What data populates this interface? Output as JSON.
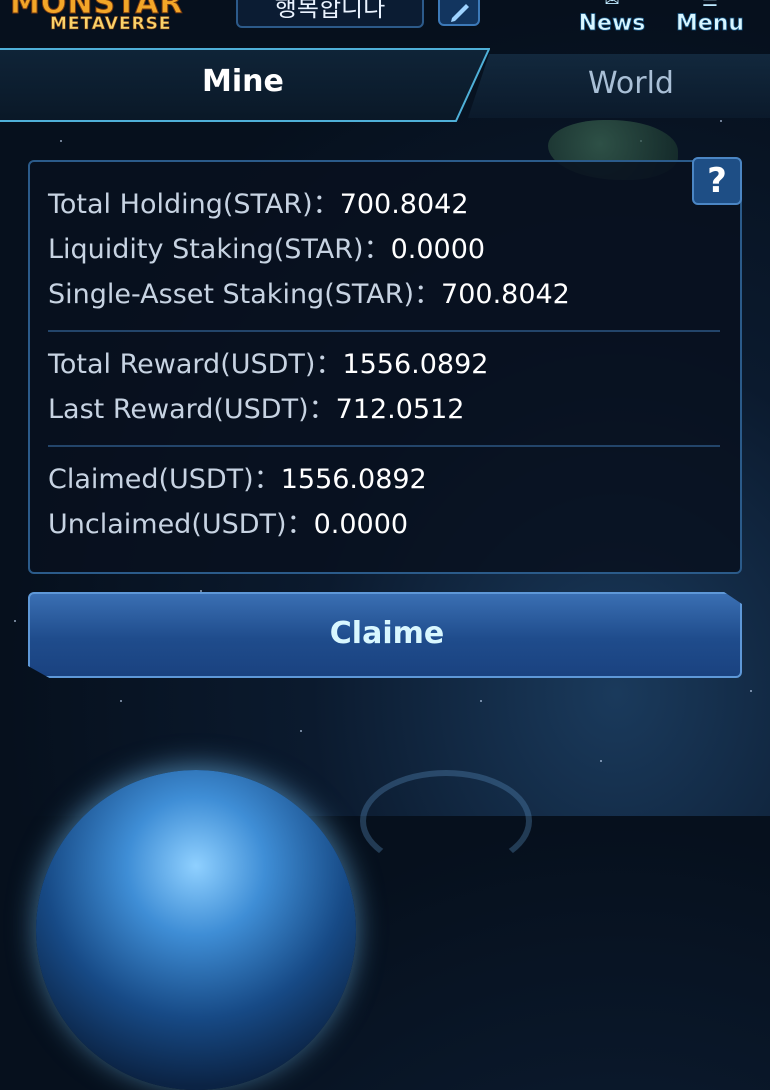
{
  "header": {
    "logo_title": "MONSTAR",
    "logo_subtitle": "METAVERSE",
    "username": "행복합니다",
    "news_label": "News",
    "menu_label": "Menu"
  },
  "tabs": [
    {
      "label": "Mine",
      "active": true
    },
    {
      "label": "World",
      "active": false
    }
  ],
  "stats": {
    "total_holding": {
      "label": "Total Holding(STAR)：",
      "value": "700.8042"
    },
    "liquidity_staking": {
      "label": "Liquidity Staking(STAR)：",
      "value": "0.0000"
    },
    "single_asset_staking": {
      "label": "Single-Asset Staking(STAR)：",
      "value": "700.8042"
    },
    "total_reward": {
      "label": "Total Reward(USDT)：",
      "value": "1556.0892"
    },
    "last_reward": {
      "label": "Last Reward(USDT)：",
      "value": "712.0512"
    },
    "claimed": {
      "label": "Claimed(USDT)：",
      "value": "1556.0892"
    },
    "unclaimed": {
      "label": "Unclaimed(USDT)：",
      "value": "0.0000"
    }
  },
  "help_label": "?",
  "claim_button_label": "Claime",
  "colors": {
    "accent_blue": "#2b5b8a",
    "button_blue": "#1f4c8c",
    "background": "#07111f"
  }
}
